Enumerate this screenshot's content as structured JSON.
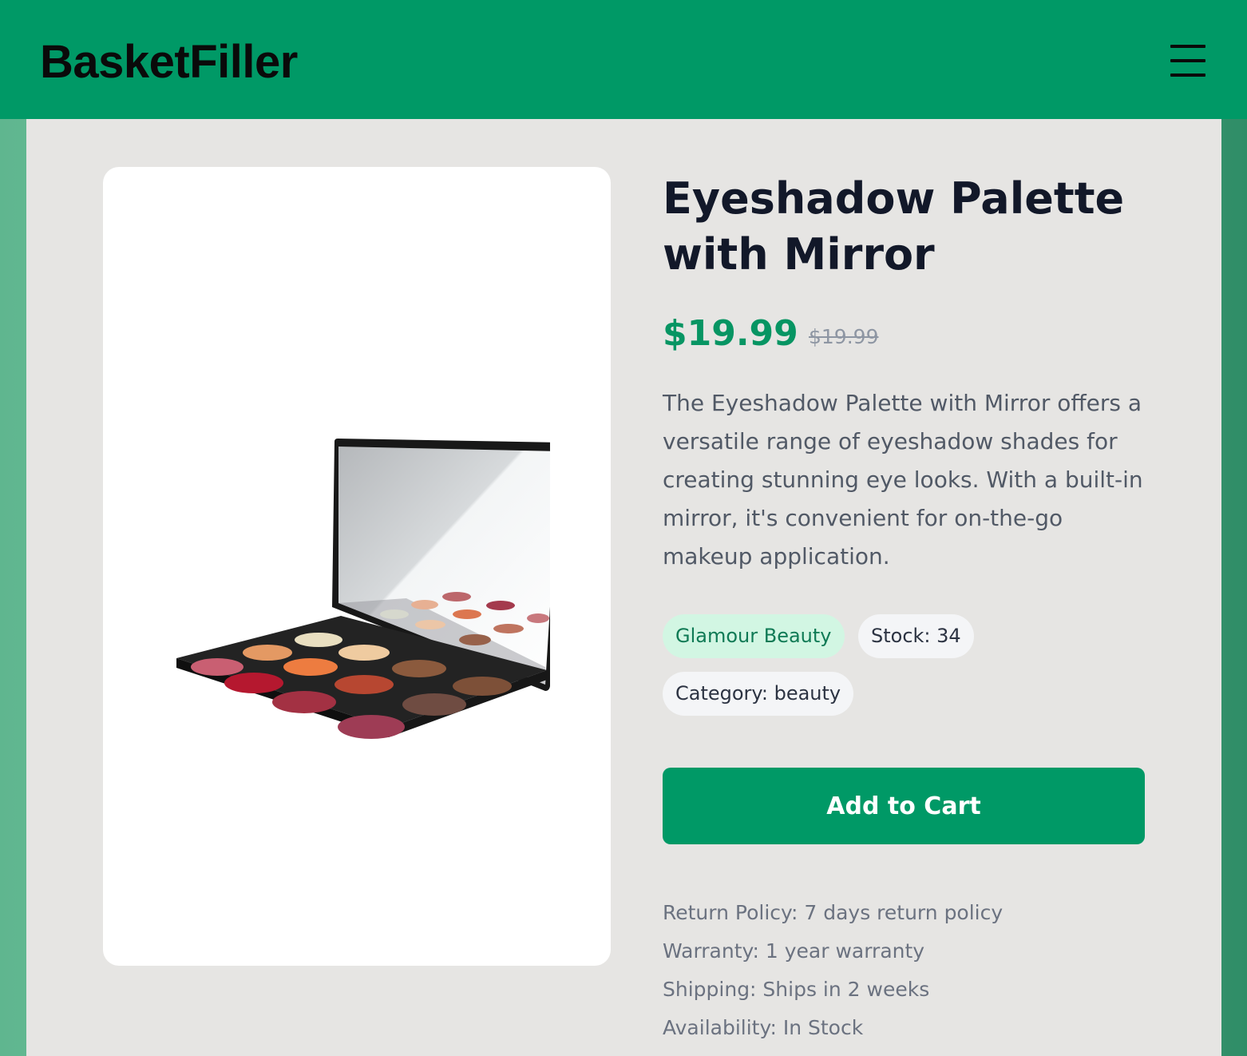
{
  "app": {
    "brand": "BasketFiller",
    "menu_icon": "hamburger-menu-icon"
  },
  "product": {
    "title": "Eyeshadow Palette with Mirror",
    "price": "$19.99",
    "original_price": "$19.99",
    "description": "The Eyeshadow Palette with Mirror offers a versatile range of eyeshadow shades for creating stunning eye looks. With a built-in mirror, it's convenient for on-the-go makeup application.",
    "brand_tag": "Glamour Beauty",
    "stock_tag": "Stock: 34",
    "category_tag": "Category: beauty",
    "add_to_cart_label": "Add to Cart",
    "details": [
      "Return Policy: 7 days return policy",
      "Warranty: 1 year warranty",
      "Shipping: Ships in 2 weeks",
      "Availability: In Stock"
    ]
  },
  "colors": {
    "header": "#009966",
    "price": "#079563",
    "button": "#009966",
    "brand_tag_bg": "#d2f6e3"
  }
}
